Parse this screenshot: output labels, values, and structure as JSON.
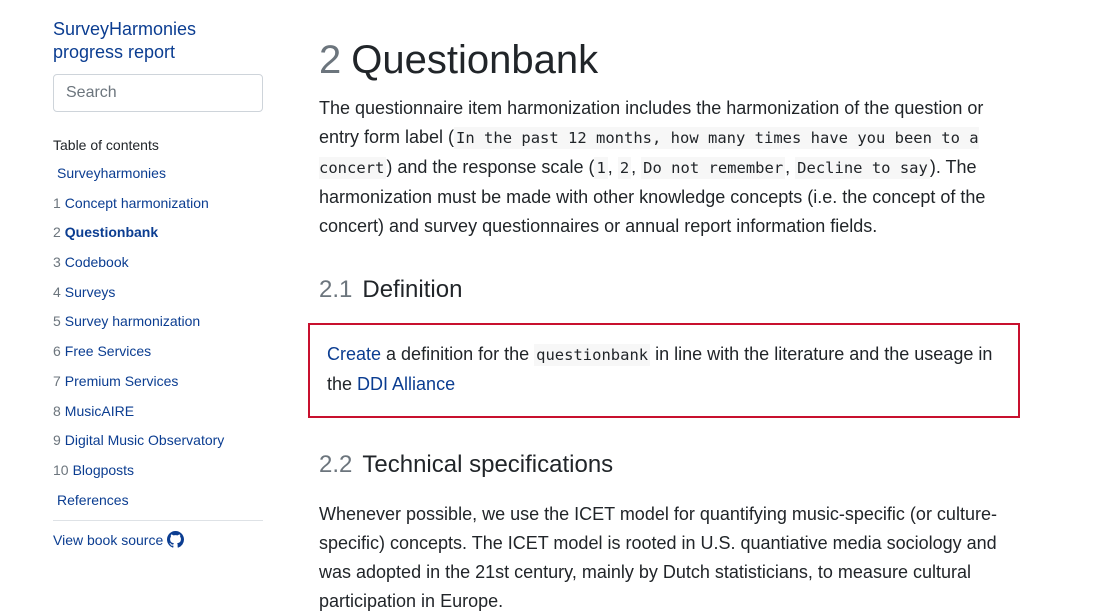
{
  "sidebar": {
    "book_title_line1": "SurveyHarmonies",
    "book_title_line2": "progress report",
    "search_placeholder": "Search",
    "toc_heading": "Table of contents",
    "items": [
      {
        "num": "",
        "label": "Surveyharmonies"
      },
      {
        "num": "1",
        "label": "Concept harmonization"
      },
      {
        "num": "2",
        "label": "Questionbank"
      },
      {
        "num": "3",
        "label": "Codebook"
      },
      {
        "num": "4",
        "label": "Surveys"
      },
      {
        "num": "5",
        "label": "Survey harmonization"
      },
      {
        "num": "6",
        "label": "Free Services"
      },
      {
        "num": "7",
        "label": "Premium Services"
      },
      {
        "num": "8",
        "label": "MusicAIRE"
      },
      {
        "num": "9",
        "label": "Digital Music Observatory"
      },
      {
        "num": "10",
        "label": "Blogposts"
      },
      {
        "num": "",
        "label": "References"
      }
    ],
    "source_link": "View book source"
  },
  "main": {
    "chapter_num": "2",
    "chapter_title": "Questionbank",
    "intro": {
      "t1": "The questionnaire item harmonization includes the harmonization of the question or entry form label (",
      "c1": "In the past 12 months, how many times have you been to a concert",
      "t2": ") and the response scale (",
      "c2": "1",
      "t3": ", ",
      "c3": "2",
      "t4": ", ",
      "c4": "Do not remember",
      "t5": ", ",
      "c5": "Decline to say",
      "t6": "). The harmonization must be made with other knowledge concepts (i.e. the concept of the concert) and survey questionnaires or annual report information fields."
    },
    "definition": {
      "num": "2.1",
      "title": "Definition",
      "link1": "Create",
      "t1": " a definition for the ",
      "code": "questionbank",
      "t2": " in line with the literature and the useage in the ",
      "link2": "DDI Alliance"
    },
    "tech": {
      "num": "2.2",
      "title": "Technical specifications",
      "text": "Whenever possible, we use the ICET model for quantifying music-specific (or culture-specific) concepts. The ICET model is rooted in U.S. quantiative media sociology and was adopted in the 21st century, mainly by Dutch statisticians, to measure cultural participation in Europe."
    }
  },
  "colors": {
    "link": "#0b3d91",
    "box_border": "#c8102e",
    "section_number": "#6c757d"
  }
}
